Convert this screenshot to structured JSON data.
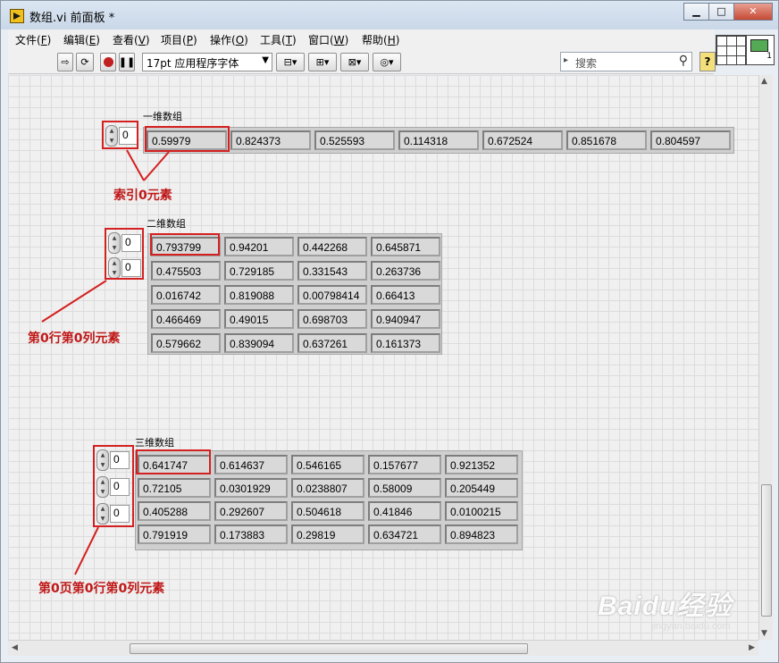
{
  "window": {
    "title": "数组.vi 前面板 *"
  },
  "menus": [
    {
      "label": "文件(",
      "key": "F",
      "end": ")"
    },
    {
      "label": "编辑(",
      "key": "E",
      "end": ")"
    },
    {
      "label": "查看(",
      "key": "V",
      "end": ")"
    },
    {
      "label": "项目(",
      "key": "P",
      "end": ")"
    },
    {
      "label": "操作(",
      "key": "O",
      "end": ")"
    },
    {
      "label": "工具(",
      "key": "T",
      "end": ")"
    },
    {
      "label": "窗口(",
      "key": "W",
      "end": ")"
    },
    {
      "label": "帮助(",
      "key": "H",
      "end": ")"
    }
  ],
  "toolbar": {
    "font": "17pt 应用程序字体",
    "search_placeholder": "搜索",
    "help": "?"
  },
  "array1d": {
    "label": "一维数组",
    "index": [
      "0"
    ],
    "rows": [
      [
        "0.59979",
        "0.824373",
        "0.525593",
        "0.114318",
        "0.672524",
        "0.851678",
        "0.804597"
      ]
    ],
    "annotation": "索引0元素"
  },
  "array2d": {
    "label": "二维数组",
    "index": [
      "0",
      "0"
    ],
    "rows": [
      [
        "0.793799",
        "0.94201",
        "0.442268",
        "0.645871"
      ],
      [
        "0.475503",
        "0.729185",
        "0.331543",
        "0.263736"
      ],
      [
        "0.016742",
        "0.819088",
        "0.00798414",
        "0.66413"
      ],
      [
        "0.466469",
        "0.49015",
        "0.698703",
        "0.940947"
      ],
      [
        "0.579662",
        "0.839094",
        "0.637261",
        "0.161373"
      ]
    ],
    "annotation": "第0行第0列元素"
  },
  "array3d": {
    "label": "三维数组",
    "index": [
      "0",
      "0",
      "0"
    ],
    "rows": [
      [
        "0.641747",
        "0.614637",
        "0.546165",
        "0.157677",
        "0.921352"
      ],
      [
        "0.72105",
        "0.0301929",
        "0.0238807",
        "0.58009",
        "0.205449"
      ],
      [
        "0.405288",
        "0.292607",
        "0.504618",
        "0.41846",
        "0.0100215"
      ],
      [
        "0.791919",
        "0.173883",
        "0.29819",
        "0.634721",
        "0.894823"
      ]
    ],
    "annotation": "第0页第0行第0列元素"
  },
  "watermark": {
    "brand": "Baidu经验",
    "url": "jingyan.baidu.com"
  },
  "colors": {
    "annotation": "#c01818",
    "highlight": "#d42020"
  }
}
